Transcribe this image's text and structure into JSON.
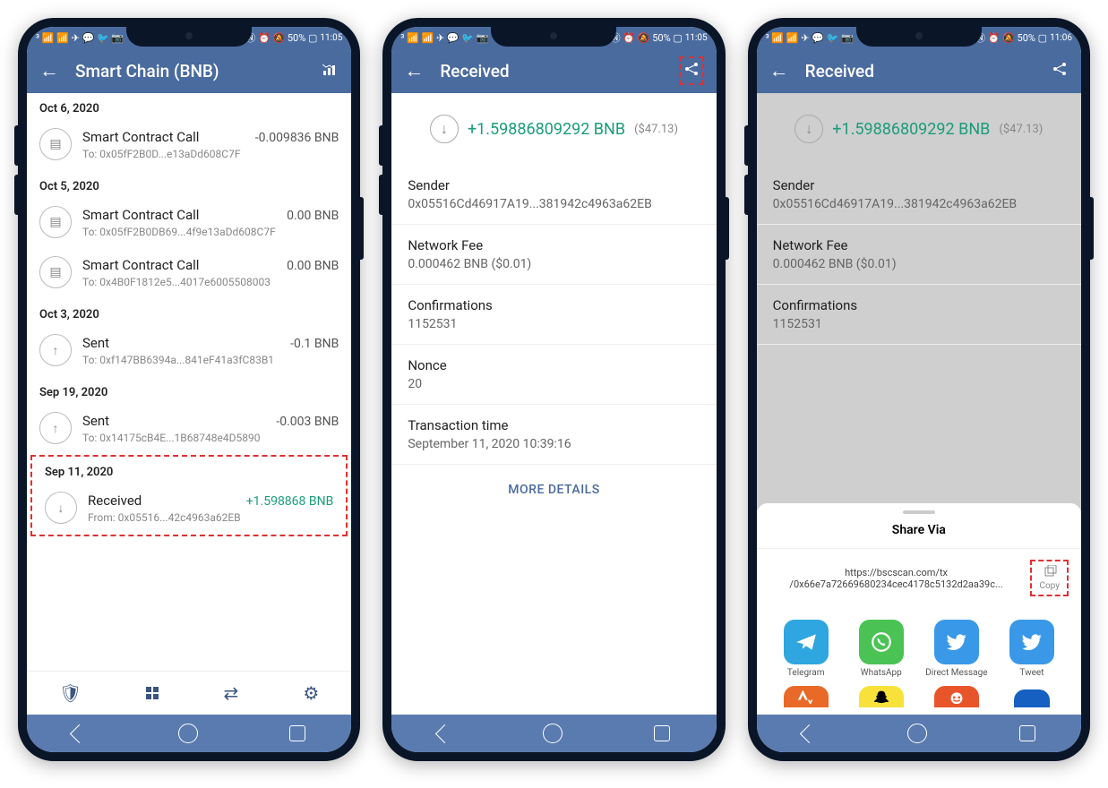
{
  "statusbar": {
    "left_icons": "³ 📶 📶 ✈ 💬 🐦 📷",
    "right_icons": "Ⓝ ⏰ 🔕 50% ▢",
    "time1": "11:05",
    "time2": "11:05",
    "time3": "11:06"
  },
  "screen1": {
    "title": "Smart Chain (BNB)",
    "sections": [
      {
        "date": "Oct 6, 2020",
        "txs": [
          {
            "icon": "contract",
            "title": "Smart Contract Call",
            "amount": "-0.009836 BNB",
            "sub": "To: 0x05fF2B0D...e13aDd608C7F"
          }
        ]
      },
      {
        "date": "Oct 5, 2020",
        "txs": [
          {
            "icon": "contract",
            "title": "Smart Contract Call",
            "amount": "0.00 BNB",
            "sub": "To: 0x05fF2B0DB69...4f9e13aDd608C7F"
          },
          {
            "icon": "contract",
            "title": "Smart Contract Call",
            "amount": "0.00 BNB",
            "sub": "To: 0x4B0F1812e5...4017e6005508003"
          }
        ]
      },
      {
        "date": "Oct 3, 2020",
        "txs": [
          {
            "icon": "sent",
            "title": "Sent",
            "amount": "-0.1 BNB",
            "sub": "To: 0xf147BB6394a...841eF41a3fC83B1"
          }
        ]
      },
      {
        "date": "Sep 19, 2020",
        "txs": [
          {
            "icon": "sent",
            "title": "Sent",
            "amount": "-0.003 BNB",
            "sub": "To: 0x14175cB4E...1B68748e4D5890"
          }
        ]
      },
      {
        "date": "Sep 11, 2020",
        "highlight": true,
        "txs": [
          {
            "icon": "recv",
            "title": "Received",
            "amount": "+1.598868 BNB",
            "amount_pos": true,
            "sub": "From: 0x05516...42c4963a62EB"
          }
        ]
      }
    ]
  },
  "screen2": {
    "title": "Received",
    "amount": "+1.59886809292 BNB",
    "amount_usd": "($47.13)",
    "fields": [
      {
        "label": "Sender",
        "value": "0x05516Cd46917A19...381942c4963a62EB"
      },
      {
        "label": "Network Fee",
        "value": "0.000462 BNB ($0.01)"
      },
      {
        "label": "Confirmations",
        "value": "1152531"
      },
      {
        "label": "Nonce",
        "value": "20"
      },
      {
        "label": "Transaction time",
        "value": "September 11, 2020 10:39:16"
      }
    ],
    "more": "MORE DETAILS"
  },
  "screen3": {
    "title": "Received",
    "amount": "+1.59886809292 BNB",
    "amount_usd": "($47.13)",
    "fields": [
      {
        "label": "Sender",
        "value": "0x05516Cd46917A19...381942c4963a62EB"
      },
      {
        "label": "Network Fee",
        "value": "0.000462 BNB ($0.01)"
      },
      {
        "label": "Confirmations",
        "value": "1152531"
      }
    ],
    "share": {
      "title": "Share Via",
      "url_line1": "https://bscscan.com/tx",
      "url_line2": "/0x66e7a72669680234cec4178c5132d2aa39c...",
      "copy": "Copy",
      "apps": [
        {
          "label": "Telegram",
          "color": "ic-telegram"
        },
        {
          "label": "WhatsApp",
          "color": "ic-whatsapp"
        },
        {
          "label": "Direct Message",
          "color": "ic-twitter"
        },
        {
          "label": "Tweet",
          "color": "ic-twitter"
        }
      ]
    }
  }
}
